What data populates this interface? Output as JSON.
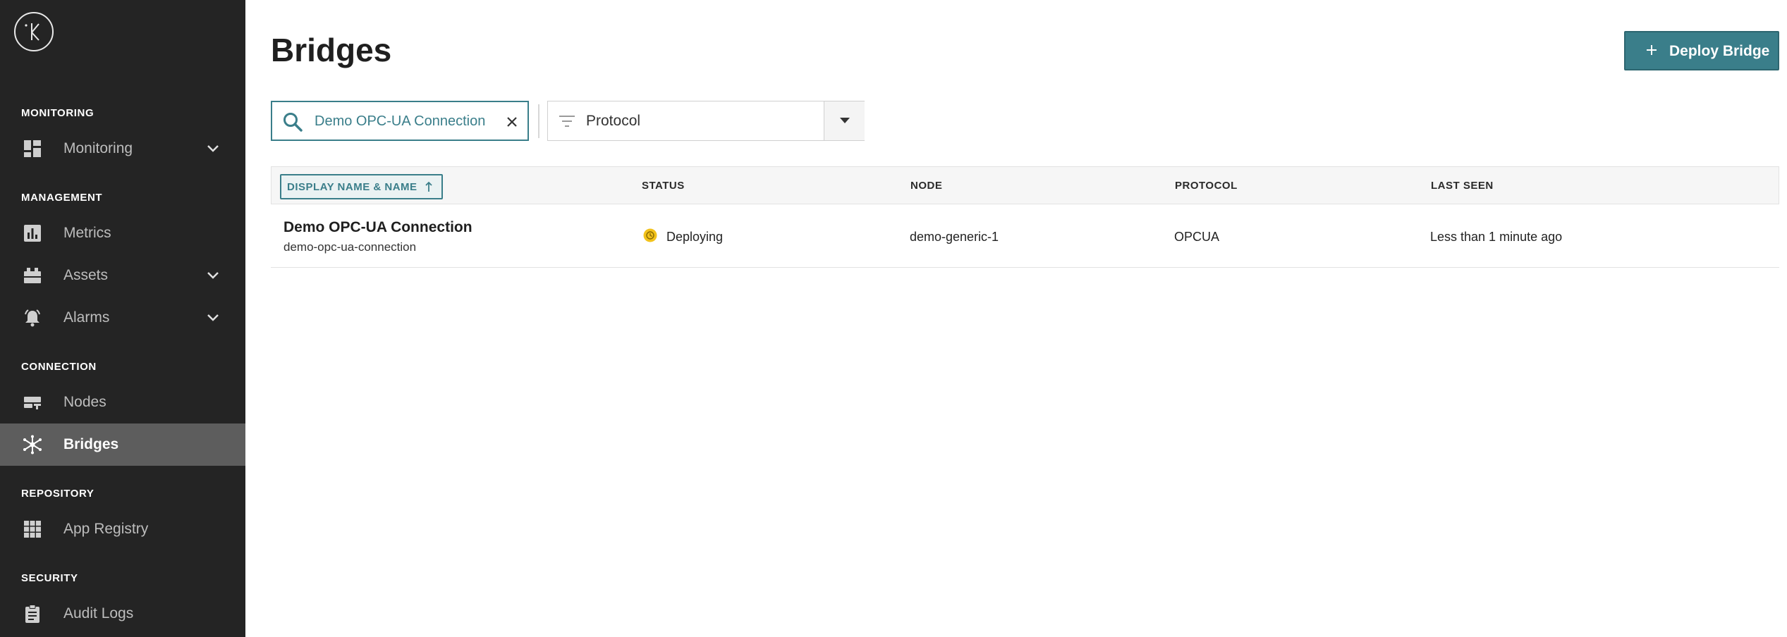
{
  "sidebar": {
    "sections": {
      "monitoring": "MONITORING",
      "management": "MANAGEMENT",
      "connection": "CONNECTION",
      "repository": "REPOSITORY",
      "security": "SECURITY"
    },
    "items": {
      "monitoring": {
        "label": "Monitoring",
        "icon": "dashboard-icon"
      },
      "metrics": {
        "label": "Metrics",
        "icon": "bar-chart-icon"
      },
      "assets": {
        "label": "Assets",
        "icon": "assets-icon"
      },
      "alarms": {
        "label": "Alarms",
        "icon": "alarm-bell-icon"
      },
      "nodes": {
        "label": "Nodes",
        "icon": "nodes-icon"
      },
      "bridges": {
        "label": "Bridges",
        "icon": "bridges-icon"
      },
      "app_registry": {
        "label": "App Registry",
        "icon": "grid-icon"
      },
      "audit_logs": {
        "label": "Audit Logs",
        "icon": "clipboard-icon"
      }
    },
    "active": "bridges"
  },
  "page": {
    "title": "Bridges",
    "deploy_button": "Deploy Bridge"
  },
  "search": {
    "value": "Demo OPC-UA Connection"
  },
  "filter": {
    "label": "Protocol"
  },
  "table": {
    "columns": {
      "name": "DISPLAY NAME & NAME",
      "status": "STATUS",
      "node": "NODE",
      "protocol": "PROTOCOL",
      "last_seen": "LAST SEEN"
    },
    "rows": [
      {
        "display_name": "Demo OPC-UA Connection",
        "name": "demo-opc-ua-connection",
        "status": "Deploying",
        "node": "demo-generic-1",
        "protocol": "OPCUA",
        "last_seen": "Less than 1 minute ago"
      }
    ]
  },
  "colors": {
    "accent": "#3a7e8a",
    "sidebar_bg": "#242424",
    "status_deploying": "#f2c21b"
  }
}
